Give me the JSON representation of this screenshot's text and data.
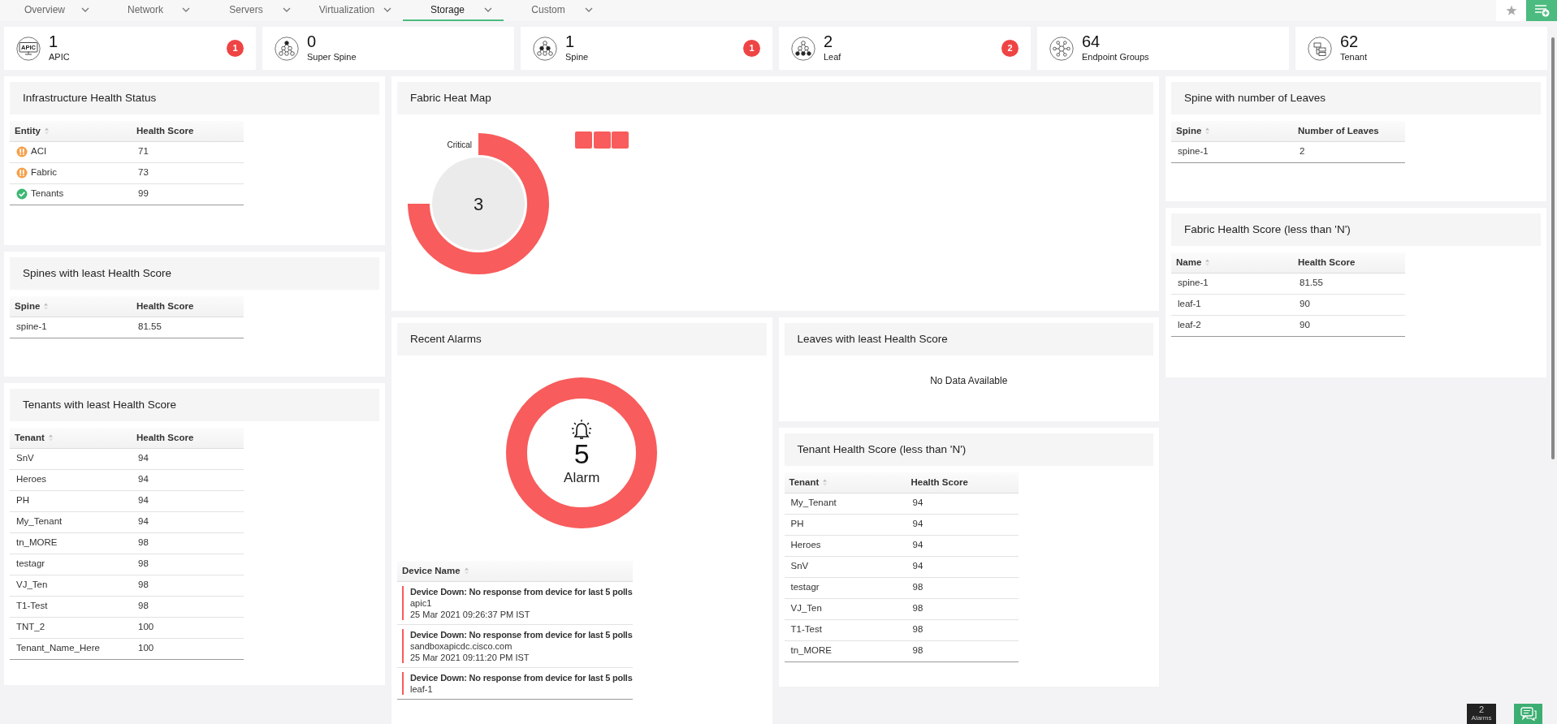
{
  "tabs": [
    {
      "label": "Overview",
      "selected": false
    },
    {
      "label": "Network",
      "selected": false
    },
    {
      "label": "Servers",
      "selected": false
    },
    {
      "label": "Virtualization",
      "selected": false
    },
    {
      "label": "Storage",
      "selected": true
    },
    {
      "label": "Custom",
      "selected": false
    }
  ],
  "summary": [
    {
      "kind": "apic",
      "icon_text": "APIC",
      "count": "1",
      "label": "APIC",
      "badge": "1"
    },
    {
      "kind": "super_spine",
      "count": "0",
      "label": "Super Spine"
    },
    {
      "kind": "spine",
      "count": "1",
      "label": "Spine",
      "badge": "1"
    },
    {
      "kind": "leaf",
      "count": "2",
      "label": "Leaf",
      "badge": "2"
    },
    {
      "kind": "endpoint_groups",
      "count": "64",
      "label": "Endpoint Groups"
    },
    {
      "kind": "tenant",
      "count": "62",
      "label": "Tenant"
    }
  ],
  "left_column": [
    {
      "kind": "table",
      "title": "Infrastructure Health Status",
      "columns": [
        {
          "label": "Entity",
          "sortable": true
        },
        {
          "label": "Health Score",
          "sortable": false
        }
      ],
      "rows": [
        {
          "kind": "warning",
          "cells": [
            "ACI",
            "71"
          ]
        },
        {
          "kind": "warning",
          "cells": [
            "Fabric",
            "73"
          ]
        },
        {
          "kind": "ok",
          "cells": [
            "Tenants",
            "99"
          ]
        }
      ]
    },
    {
      "kind": "table",
      "title": "Spines with least Health Score",
      "columns": [
        {
          "label": "Spine",
          "sortable": true
        },
        {
          "label": "Health Score",
          "sortable": false
        }
      ],
      "rows": [
        {
          "cells": [
            "spine-1",
            "81.55"
          ]
        }
      ]
    },
    {
      "kind": "table",
      "title": "Tenants with least Health Score",
      "columns": [
        {
          "label": "Tenant",
          "sortable": true
        },
        {
          "label": "Health Score",
          "sortable": false
        }
      ],
      "rows": [
        {
          "cells": [
            "SnV",
            "94"
          ]
        },
        {
          "cells": [
            "Heroes",
            "94"
          ]
        },
        {
          "cells": [
            "PH",
            "94"
          ]
        },
        {
          "cells": [
            "My_Tenant",
            "94"
          ]
        },
        {
          "cells": [
            "tn_MORE",
            "98"
          ]
        },
        {
          "cells": [
            "testagr",
            "98"
          ]
        },
        {
          "cells": [
            "VJ_Ten",
            "98"
          ]
        },
        {
          "cells": [
            "T1-Test",
            "98"
          ]
        },
        {
          "cells": [
            "TNT_2",
            "100"
          ]
        },
        {
          "cells": [
            "Tenant_Name_Here",
            "100"
          ]
        }
      ]
    }
  ],
  "middle_column": {
    "heat_map": {
      "title": "Fabric Heat Map",
      "ring_label": "Critical",
      "center_value": "3",
      "cells": [
        {
          "color": "#f85c5c"
        },
        {
          "color": "#f85c5c"
        },
        {
          "color": "#f85c5c"
        }
      ]
    },
    "recent_alarms": {
      "title": "Recent Alarms",
      "count": "5",
      "count_label": "Alarm",
      "columns": [
        {
          "label": "Device Name",
          "sortable": true
        }
      ],
      "alarms": [
        {
          "color": "#f85c5c",
          "message": "Device Down: No response from device for last 5 polls",
          "device": "apic1",
          "time": "25 Mar 2021 09:26:37 PM IST"
        },
        {
          "color": "#f85c5c",
          "message": "Device Down: No response from device for last 5 polls",
          "device": "sandboxapicdc.cisco.com",
          "time": "25 Mar 2021 09:11:20 PM IST"
        },
        {
          "color": "#f85c5c",
          "message": "Device Down: No response from device for last 5 polls",
          "device": "leaf-1"
        }
      ]
    },
    "side_panels": [
      {
        "kind": "message",
        "title": "Leaves with least Health Score",
        "message": "No Data Available"
      },
      {
        "kind": "table",
        "title": "Tenant Health Score (less than 'N')",
        "columns": [
          {
            "label": "Tenant",
            "sortable": true
          },
          {
            "label": "Health Score",
            "sortable": false
          }
        ],
        "rows": [
          {
            "cells": [
              "My_Tenant",
              "94"
            ]
          },
          {
            "cells": [
              "PH",
              "94"
            ]
          },
          {
            "cells": [
              "Heroes",
              "94"
            ]
          },
          {
            "cells": [
              "SnV",
              "94"
            ]
          },
          {
            "cells": [
              "testagr",
              "98"
            ]
          },
          {
            "cells": [
              "VJ_Ten",
              "98"
            ]
          },
          {
            "cells": [
              "T1-Test",
              "98"
            ]
          },
          {
            "cells": [
              "tn_MORE",
              "98"
            ]
          }
        ]
      }
    ]
  },
  "right_column": [
    {
      "kind": "table",
      "title": "Spine with number of Leaves",
      "columns": [
        {
          "label": "Spine",
          "sortable": true
        },
        {
          "label": "Number of Leaves",
          "sortable": false
        }
      ],
      "rows": [
        {
          "cells": [
            "spine-1",
            "2"
          ]
        }
      ]
    },
    {
      "kind": "table",
      "title": "Fabric Health Score (less than 'N')",
      "columns": [
        {
          "label": "Name",
          "sortable": true
        },
        {
          "label": "Health Score",
          "sortable": false
        }
      ],
      "rows": [
        {
          "cells": [
            "spine-1",
            "81.55"
          ]
        },
        {
          "cells": [
            "leaf-1",
            "90"
          ]
        },
        {
          "cells": [
            "leaf-2",
            "90"
          ]
        }
      ]
    }
  ],
  "alarm_widget": {
    "count": "2",
    "label": "Alarms"
  }
}
